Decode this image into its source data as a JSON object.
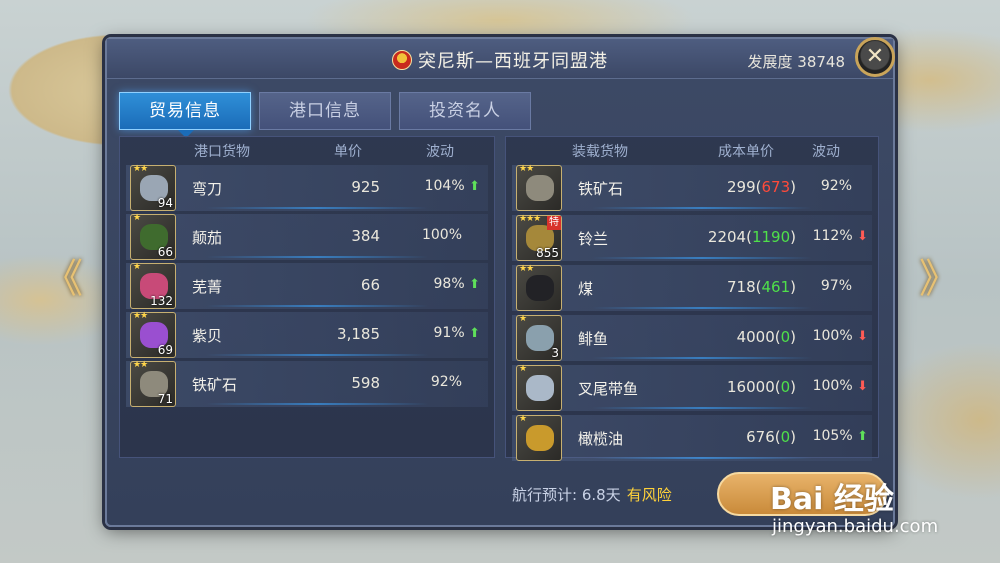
{
  "window": {
    "title": "突尼斯—西班牙同盟港",
    "development_label": "发展度",
    "development_value": "38748",
    "close_label": "✕"
  },
  "tabs": [
    {
      "label": "贸易信息",
      "active": true
    },
    {
      "label": "港口信息",
      "active": false
    },
    {
      "label": "投资名人",
      "active": false
    }
  ],
  "port_goods": {
    "headers": {
      "goods": "港口货物",
      "price": "单价",
      "fluct": "波动"
    },
    "items": [
      {
        "name": "弯刀",
        "stars": "★★",
        "qty": "94",
        "price": "925",
        "pct": "104%",
        "trend": "up",
        "icon": "scimitar-icon"
      },
      {
        "name": "颠茄",
        "stars": "★",
        "qty": "66",
        "price": "384",
        "pct": "100%",
        "trend": "",
        "icon": "belladonna-icon"
      },
      {
        "name": "芜菁",
        "stars": "★",
        "qty": "132",
        "price": "66",
        "pct": "98%",
        "trend": "up",
        "icon": "turnip-icon"
      },
      {
        "name": "紫贝",
        "stars": "★★",
        "qty": "69",
        "price": "3,185",
        "pct": "91%",
        "trend": "up",
        "icon": "purple-shell-icon"
      },
      {
        "name": "铁矿石",
        "stars": "★★",
        "qty": "71",
        "price": "598",
        "pct": "92%",
        "trend": "",
        "icon": "iron-ore-icon"
      }
    ]
  },
  "cargo": {
    "headers": {
      "goods": "装载货物",
      "cost": "成本单价",
      "fluct": "波动"
    },
    "items": [
      {
        "name": "铁矿石",
        "stars": "★★",
        "qty": "",
        "special": "",
        "cost": "299",
        "diff": "673",
        "diff_color": "red",
        "pct": "92%",
        "trend": "",
        "icon": "iron-ore-icon"
      },
      {
        "name": "铃兰",
        "stars": "★★★",
        "qty": "855",
        "special": "特",
        "cost": "2204",
        "diff": "1190",
        "diff_color": "green",
        "pct": "112%",
        "trend": "down",
        "icon": "lily-of-valley-icon"
      },
      {
        "name": "煤",
        "stars": "★★",
        "qty": "",
        "special": "",
        "cost": "718",
        "diff": "461",
        "diff_color": "green",
        "pct": "97%",
        "trend": "",
        "icon": "coal-icon"
      },
      {
        "name": "鲱鱼",
        "stars": "★",
        "qty": "3",
        "special": "",
        "cost": "4000",
        "diff": "0",
        "diff_color": "green",
        "pct": "100%",
        "trend": "down",
        "icon": "herring-icon"
      },
      {
        "name": "叉尾带鱼",
        "stars": "★",
        "qty": "",
        "special": "",
        "cost": "16000",
        "diff": "0",
        "diff_color": "green",
        "pct": "100%",
        "trend": "down",
        "icon": "hairtail-icon"
      },
      {
        "name": "橄榄油",
        "stars": "★",
        "qty": "",
        "special": "",
        "cost": "676",
        "diff": "0",
        "diff_color": "green",
        "pct": "105%",
        "trend": "up",
        "icon": "olive-oil-icon"
      }
    ]
  },
  "footer": {
    "voyage_label": "航行预计: 6.8天",
    "risk_label": "有风险"
  },
  "nav": {
    "left": "《",
    "right": "》"
  },
  "watermark": {
    "logo": "Bai 经验",
    "url": "jingyan.baidu.com"
  },
  "colors": {
    "accent": "#1b6cb8",
    "up": "#5fe05a",
    "down": "#ff5b55",
    "gold": "#c9a45a"
  }
}
